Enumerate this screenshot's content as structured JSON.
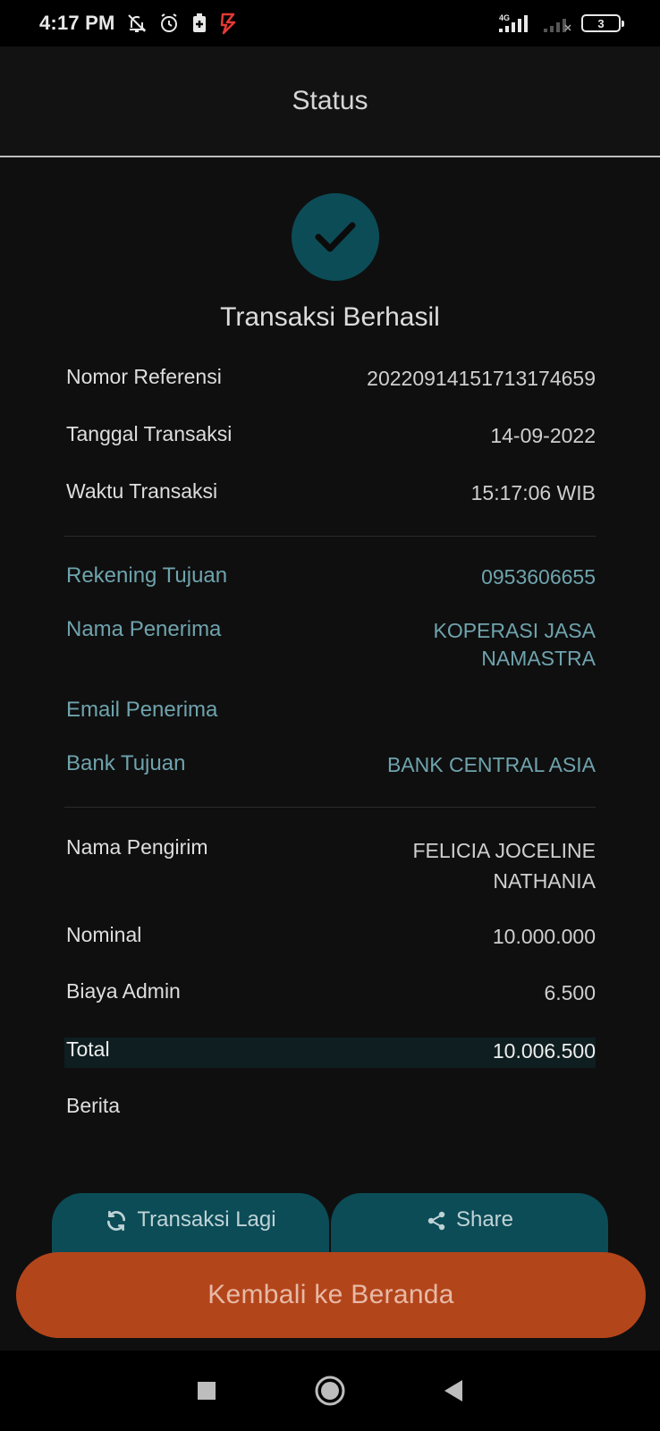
{
  "status_bar": {
    "time": "4:17 PM",
    "network_label": "4G",
    "battery_level": "3"
  },
  "header": {
    "title": "Status"
  },
  "result": {
    "title": "Transaksi Berhasil"
  },
  "transaction": {
    "reference": {
      "label": "Nomor Referensi",
      "value": "20220914151713174659"
    },
    "date": {
      "label": "Tanggal Transaksi",
      "value": "14-09-2022"
    },
    "time": {
      "label": "Waktu Transaksi",
      "value": "15:17:06 WIB"
    }
  },
  "recipient": {
    "account": {
      "label": "Rekening Tujuan",
      "value": "0953606655"
    },
    "name": {
      "label": "Nama Penerima",
      "value_line1": "KOPERASI JASA",
      "value_line2": "NAMASTRA"
    },
    "email": {
      "label": "Email Penerima",
      "value": ""
    },
    "bank": {
      "label": "Bank Tujuan",
      "value": "BANK CENTRAL ASIA"
    }
  },
  "sender": {
    "name": {
      "label": "Nama Pengirim",
      "value_line1": "FELICIA JOCELINE",
      "value_line2": "NATHANIA"
    },
    "amount": {
      "label": "Nominal",
      "value": "10.000.000"
    },
    "fee": {
      "label": "Biaya Admin",
      "value": "6.500"
    },
    "total": {
      "label": "Total",
      "value": "10.006.500"
    },
    "note": {
      "label": "Berita",
      "value": ""
    }
  },
  "actions": {
    "repeat_label": "Transaksi Lagi",
    "share_label": "Share",
    "home_label": "Kembali ke Beranda"
  },
  "colors": {
    "accent_teal": "#0c4c57",
    "teal_text": "#6fa3ad",
    "primary_orange": "#b3451b",
    "background": "#0f0f0f"
  },
  "icons": [
    "bell-off-icon",
    "alarm-icon",
    "battery-saver-icon",
    "app-notification-icon",
    "signal-icon",
    "signal-empty-icon",
    "battery-icon",
    "check-icon",
    "refresh-icon",
    "share-icon",
    "recents-square-icon",
    "home-circle-icon",
    "back-triangle-icon"
  ]
}
